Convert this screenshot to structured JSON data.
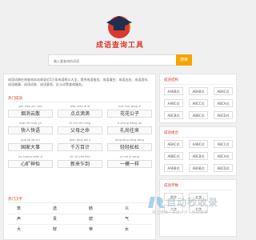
{
  "header": {
    "site_name": "成语查询工具",
    "search_placeholder": "输入要查询的词语",
    "search_button": "搜索"
  },
  "main": {
    "intro": "成语词典在线查询本站收录近5万条成语释义大全，提供成语接龙、成语填空、成语出处、成语造句、成语故事、成语词条、成语意思、反义词等查询服务。",
    "section1_title": "热门成语",
    "idioms": [
      {
        "py": "yān xiāo yún sàn",
        "hz": "烟消云散"
      },
      {
        "py": "diǎn diǎn dī dī",
        "hz": "点点滴滴"
      },
      {
        "py": "huā huā gōng zǐ",
        "hz": "花花公子"
      },
      {
        "py": "kuài rén kuài yǔ",
        "hz": "快人快语"
      },
      {
        "py": "fù mǔ zhī mìng",
        "hz": "父母之命"
      },
      {
        "py": "lǐ shàng wǎng lái",
        "hz": "礼尚往来"
      },
      {
        "py": "guó jiā dà shì",
        "hz": "国家大事"
      },
      {
        "py": "qiān fāng bǎi jì",
        "hz": "千方百计"
      },
      {
        "py": "qīng qīng sōng sōng",
        "hz": "轻轻松松"
      },
      {
        "py": "xīn kuàng shén yí",
        "hz": "心旷神怡"
      },
      {
        "py": "xīn lái zhà dào",
        "hz": "新来乍到"
      },
      {
        "py": "yī mó yī yàng",
        "hz": "一模一样"
      }
    ],
    "section2_title": "热门汉字",
    "chars": [
      "筑",
      "选",
      "骸",
      "义",
      "声",
      "贵",
      "窟",
      "气",
      "大",
      "鲜",
      "帝",
      "女"
    ]
  },
  "sidebar": {
    "box1": {
      "title": "成语结构",
      "tags": [
        "AABB式",
        "ABAB式",
        "ABAC式",
        "AABC式",
        "ABCC式",
        "ABCA式",
        "ABCB式",
        "ABBC式",
        "ABCD式"
      ]
    },
    "box2": {
      "title": "成语组合",
      "tags": [
        "ABAC式",
        "AABC式",
        "ABCC式",
        "ABBC式",
        "ABCB式",
        "ABCA式",
        "AABB式",
        "ABAB式",
        "ABCD式"
      ]
    },
    "box3": {
      "title": "成语字数",
      "tags": [
        "四字",
        "五字",
        "六字",
        "七字"
      ]
    }
  },
  "watermark": {
    "text": "自动秒收录",
    "sub": "做上链接 · 来访一次 · 自动收录"
  }
}
